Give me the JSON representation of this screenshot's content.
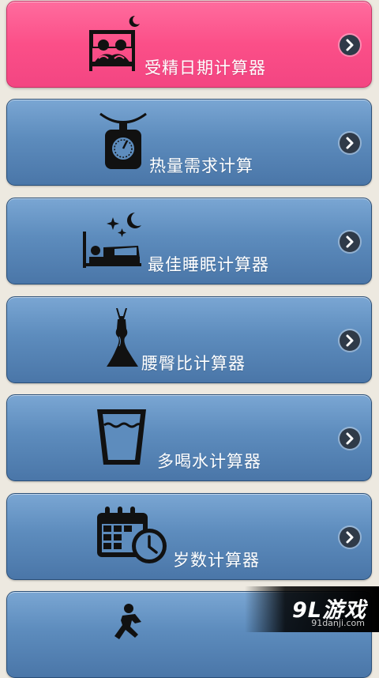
{
  "items": [
    {
      "label": "受精日期计算器",
      "icon": "couple-bed-moon-icon",
      "highlighted": true
    },
    {
      "label": "热量需求计算",
      "icon": "kitchen-scale-icon",
      "highlighted": false
    },
    {
      "label": "最佳睡眠计算器",
      "icon": "sleeping-person-stars-icon",
      "highlighted": false
    },
    {
      "label": "腰臀比计算器",
      "icon": "dress-icon",
      "highlighted": false
    },
    {
      "label": "多喝水计算器",
      "icon": "water-glass-icon",
      "highlighted": false
    },
    {
      "label": "岁数计算器",
      "icon": "calendar-clock-icon",
      "highlighted": false
    },
    {
      "label": "",
      "icon": "runner-icon",
      "highlighted": false
    }
  ],
  "watermark": {
    "brand": "9L游戏",
    "url": "91danji.com"
  },
  "colors": {
    "background": "#ede9e0",
    "card_blue": "#5d8cbd",
    "card_pink": "#fb4f88",
    "chevron": "#2f3a48"
  }
}
